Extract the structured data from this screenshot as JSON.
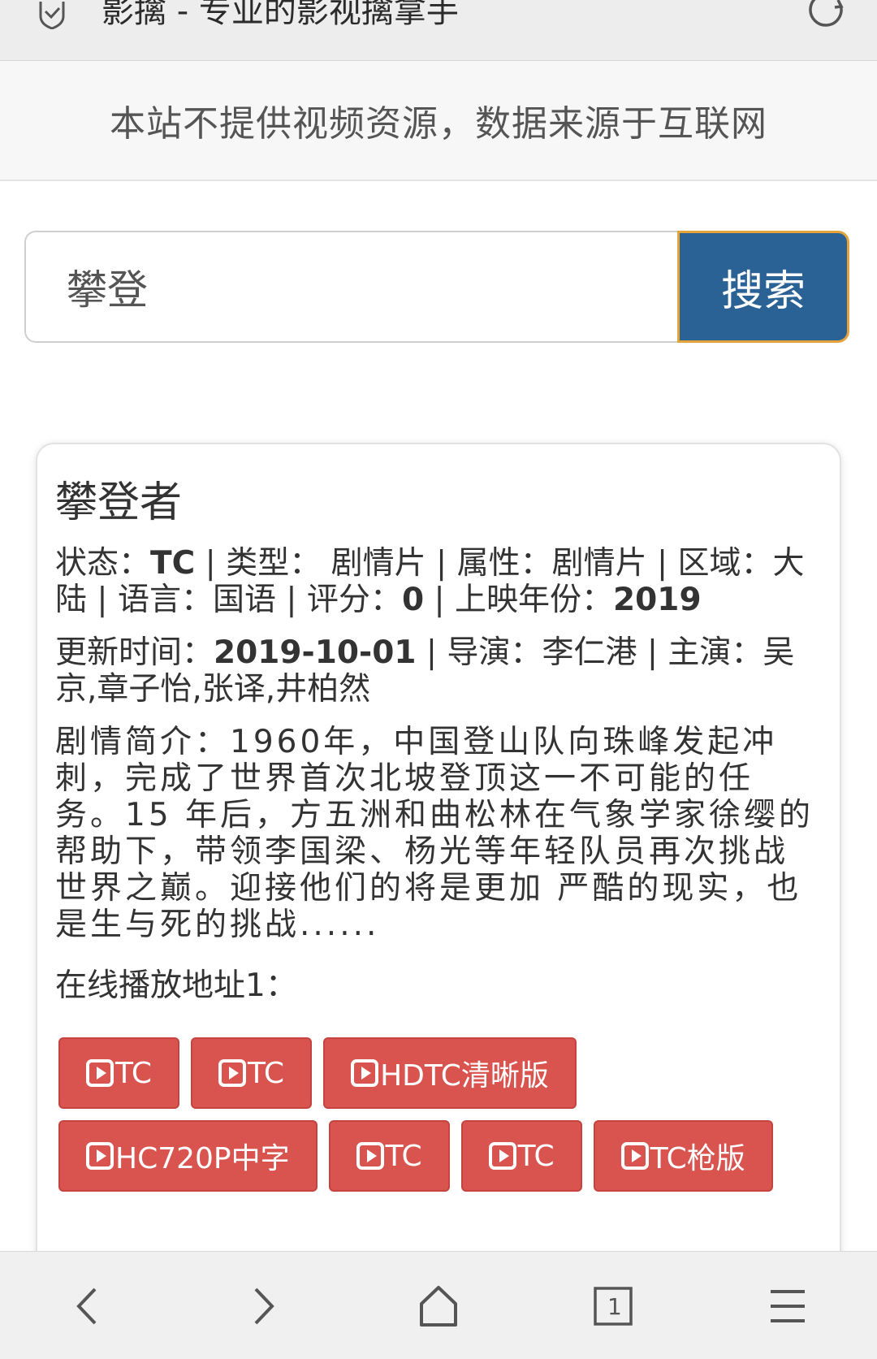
{
  "browser": {
    "title": "影擒 - 专业的影视擒拿手"
  },
  "notice": "本站不提供视频资源，数据来源于互联网",
  "search": {
    "value": "攀登",
    "button_label": "搜索"
  },
  "result": {
    "title": "攀登者",
    "status_label": "状态：",
    "status": "TC",
    "genre_label": "类型：",
    "genre": "剧情片",
    "attr_label": "属性：",
    "attr": "剧情片",
    "region_label": "区域：",
    "region": "大陆",
    "language_label": "语言：",
    "language": "国语",
    "rating_label": "评分：",
    "rating": "0",
    "year_label": "上映年份：",
    "year": "2019",
    "updated_label": "更新时间：",
    "updated": "2019-10-01",
    "director_label": "导演：",
    "director": "李仁港",
    "cast_label": "主演：",
    "cast": "吴京,章子怡,张译,井柏然",
    "synopsis_label": "剧情简介：",
    "synopsis": "1960年，中国登山队向珠峰发起冲刺，完成了世界首次北坡登顶这一不可能的任务。15 年后，方五洲和曲松林在气象学家徐缨的帮助下，带领李国梁、杨光等年轻队员再次挑战世界之巅。迎接他们的将是更加 严酷的现实，也是生与死的挑战......",
    "play_label": "在线播放地址1：",
    "play_buttons": [
      "TC",
      "TC",
      "HDTC清晰版",
      "HC720P中字",
      "TC",
      "TC",
      "TC枪版"
    ]
  },
  "colors": {
    "search_button": "#2b6296",
    "search_button_border": "#e3a53b",
    "play_button": "#d9534f"
  },
  "nav": {
    "tab_count": "1"
  },
  "icons": [
    "shield-check-icon",
    "reload-icon",
    "play-icon",
    "back-icon",
    "forward-icon",
    "home-icon",
    "tabs-icon",
    "menu-icon"
  ]
}
